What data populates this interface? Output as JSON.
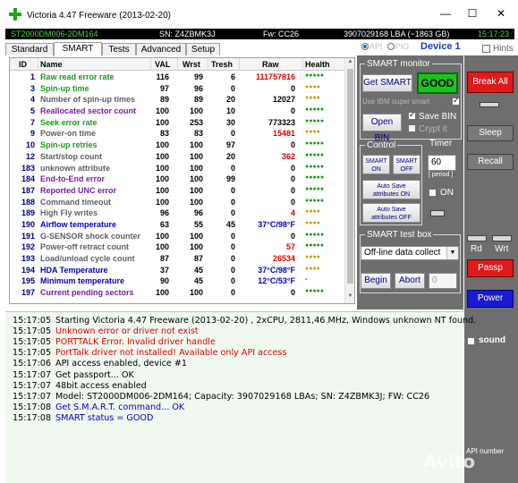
{
  "window": {
    "title": "Victoria 4.47  Freeware (2013-02-20)",
    "minimize": "—",
    "maximize": "☐",
    "close": "✕"
  },
  "infobar": {
    "model": "ST2000DM006-2DM164",
    "sn": "SN: Z4ZBMK3J",
    "fw": "Fw: CC26",
    "lba": "3907029168 LBA (~1863 GB)",
    "time": "15:17:23"
  },
  "tabs": [
    "Standard",
    "SMART",
    "Tests",
    "Advanced",
    "Setup"
  ],
  "active_tab": "SMART",
  "api_options": {
    "api": "API",
    "pio": "PIO",
    "selected": "API"
  },
  "device_label": "Device 1",
  "hints_label": "Hints",
  "table": {
    "headers": [
      "ID",
      "Name",
      "VAL",
      "Wrst",
      "Tresh",
      "Raw",
      "Health"
    ],
    "rows": [
      {
        "id": "1",
        "name": "Raw read error rate",
        "val": "116",
        "wrst": "99",
        "tresh": "6",
        "raw": "111757816",
        "health": "●●●●●",
        "name_color": "#1a9a1a",
        "raw_color": "#e00000",
        "health_color": "#1a9a1a"
      },
      {
        "id": "3",
        "name": "Spin-up time",
        "val": "97",
        "wrst": "96",
        "tresh": "0",
        "raw": "0",
        "health": "●●●●",
        "name_color": "#1a9a1a",
        "raw_color": "#000000",
        "health_color": "#c8a000"
      },
      {
        "id": "4",
        "name": "Number of spin-up times",
        "val": "89",
        "wrst": "89",
        "tresh": "20",
        "raw": "12027",
        "health": "●●●●",
        "name_color": "#606060",
        "raw_color": "#000000",
        "health_color": "#c8a000"
      },
      {
        "id": "5",
        "name": "Reallocated sector count",
        "val": "100",
        "wrst": "100",
        "tresh": "10",
        "raw": "0",
        "health": "●●●●●",
        "name_color": "#7a1aa8",
        "raw_color": "#000000",
        "health_color": "#1a9a1a"
      },
      {
        "id": "7",
        "name": "Seek error rate",
        "val": "100",
        "wrst": "253",
        "tresh": "30",
        "raw": "773323",
        "health": "●●●●●",
        "name_color": "#1a9a1a",
        "raw_color": "#000000",
        "health_color": "#1a9a1a"
      },
      {
        "id": "9",
        "name": "Power-on time",
        "val": "83",
        "wrst": "83",
        "tresh": "0",
        "raw": "15481",
        "health": "●●●●",
        "name_color": "#606060",
        "raw_color": "#e00000",
        "health_color": "#c8a000"
      },
      {
        "id": "10",
        "name": "Spin-up retries",
        "val": "100",
        "wrst": "100",
        "tresh": "97",
        "raw": "0",
        "health": "●●●●●",
        "name_color": "#1a9a1a",
        "raw_color": "#000000",
        "health_color": "#1a9a1a"
      },
      {
        "id": "12",
        "name": "Start/stop count",
        "val": "100",
        "wrst": "100",
        "tresh": "20",
        "raw": "362",
        "health": "●●●●●",
        "name_color": "#606060",
        "raw_color": "#e00000",
        "health_color": "#1a9a1a"
      },
      {
        "id": "183",
        "name": "unknown attribute",
        "val": "100",
        "wrst": "100",
        "tresh": "0",
        "raw": "0",
        "health": "●●●●●",
        "name_color": "#606060",
        "raw_color": "#000000",
        "health_color": "#1a9a1a"
      },
      {
        "id": "184",
        "name": "End-to-End error",
        "val": "100",
        "wrst": "100",
        "tresh": "99",
        "raw": "0",
        "health": "●●●●●",
        "name_color": "#7a1aa8",
        "raw_color": "#000000",
        "health_color": "#1a9a1a"
      },
      {
        "id": "187",
        "name": "Reported UNC error",
        "val": "100",
        "wrst": "100",
        "tresh": "0",
        "raw": "0",
        "health": "●●●●●",
        "name_color": "#7a1aa8",
        "raw_color": "#000000",
        "health_color": "#1a9a1a"
      },
      {
        "id": "188",
        "name": "Command timeout",
        "val": "100",
        "wrst": "100",
        "tresh": "0",
        "raw": "0",
        "health": "●●●●●",
        "name_color": "#606060",
        "raw_color": "#000000",
        "health_color": "#1a9a1a"
      },
      {
        "id": "189",
        "name": "High Fly writes",
        "val": "96",
        "wrst": "96",
        "tresh": "0",
        "raw": "4",
        "health": "●●●●",
        "name_color": "#606060",
        "raw_color": "#e00000",
        "health_color": "#c8a000"
      },
      {
        "id": "190",
        "name": "Airflow temperature",
        "val": "63",
        "wrst": "55",
        "tresh": "45",
        "raw": "37°C/98°F",
        "health": "●●●●",
        "name_color": "#0000c8",
        "raw_color": "#0000c8",
        "health_color": "#c8a000"
      },
      {
        "id": "191",
        "name": "G-SENSOR shock counter",
        "val": "100",
        "wrst": "100",
        "tresh": "0",
        "raw": "0",
        "health": "●●●●●",
        "name_color": "#606060",
        "raw_color": "#000000",
        "health_color": "#1a9a1a"
      },
      {
        "id": "192",
        "name": "Power-off retract count",
        "val": "100",
        "wrst": "100",
        "tresh": "0",
        "raw": "57",
        "health": "●●●●●",
        "name_color": "#606060",
        "raw_color": "#e00000",
        "health_color": "#1a9a1a"
      },
      {
        "id": "193",
        "name": "Load/unload cycle count",
        "val": "87",
        "wrst": "87",
        "tresh": "0",
        "raw": "26534",
        "health": "●●●●",
        "name_color": "#606060",
        "raw_color": "#e00000",
        "health_color": "#c8a000"
      },
      {
        "id": "194",
        "name": "HDA Temperature",
        "val": "37",
        "wrst": "45",
        "tresh": "0",
        "raw": "37°C/98°F",
        "health": "●●●●",
        "name_color": "#0000c8",
        "raw_color": "#0000c8",
        "health_color": "#c8a000"
      },
      {
        "id": "195",
        "name": "Minimum temperature",
        "val": "90",
        "wrst": "45",
        "tresh": "0",
        "raw": "12°C/53°F",
        "health": "-",
        "name_color": "#0000c8",
        "raw_color": "#0000c8",
        "health_color": "#000000"
      },
      {
        "id": "197",
        "name": "Current pending sectors",
        "val": "100",
        "wrst": "100",
        "tresh": "0",
        "raw": "0",
        "health": "●●●●●",
        "name_color": "#7a1aa8",
        "raw_color": "#000000",
        "health_color": "#1a9a1a"
      }
    ]
  },
  "smart_monitor": {
    "title": "SMART monitor",
    "get_smart": "Get SMART",
    "status": "GOOD",
    "status_color": "#19c419",
    "use_ibm": "Use IBM super smart",
    "open_bin": "Open BIN",
    "save_bin": "Save BIN",
    "crypt_it": "Crypt it"
  },
  "control": {
    "title": "Control",
    "smart_on": "SMART ON",
    "smart_off": "SMART OFF",
    "autosave_on": "Auto Save attributes ON",
    "autosave_off": "Auto Save attributes OFF"
  },
  "timer": {
    "title": "Timer",
    "value": "60",
    "period_label": "[ period ]",
    "on_label": "ON"
  },
  "test_box": {
    "title": "SMART test box",
    "selected_test": "Off-line data collect",
    "begin": "Begin",
    "abort": "Abort",
    "progress_value": "0"
  },
  "side_buttons": {
    "break_all": "Break All",
    "sleep": "Sleep",
    "recall": "Recall",
    "rd": "Rd",
    "wrt": "Wrt",
    "passp": "Passp",
    "power": "Power",
    "sound": "sound",
    "api_number": "API number"
  },
  "log": [
    {
      "time": "15:17:05",
      "msg": "Starting Victoria 4.47  Freeware (2013-02-20) , 2xCPU, 2811,46 MHz, Windows unknown NT found.",
      "color": "#000000"
    },
    {
      "time": "15:17:05",
      "msg": "Unknown error or driver not exist",
      "color": "#e00000"
    },
    {
      "time": "15:17:05",
      "msg": "PORTTALK Error. Invalid driver handle",
      "color": "#e00000"
    },
    {
      "time": "15:17:05",
      "msg": "PortTalk driver not installed! Available only API access",
      "color": "#e00000"
    },
    {
      "time": "15:17:06",
      "msg": "API access enabled, device #1",
      "color": "#000000"
    },
    {
      "time": "15:17:07",
      "msg": "Get passport... OK",
      "color": "#000000"
    },
    {
      "time": "15:17:07",
      "msg": "48bit access enabled",
      "color": "#000000"
    },
    {
      "time": "15:17:07",
      "msg": "Model: ST2000DM006-2DM164; Capacity: 3907029168 LBAs; SN: Z4ZBMK3J; FW: CC26",
      "color": "#000000"
    },
    {
      "time": "15:17:08",
      "msg": "Get S.M.A.R.T. command... OK",
      "color": "#0000c8"
    },
    {
      "time": "15:17:08",
      "msg": "SMART status = GOOD",
      "color": "#0000c8"
    }
  ],
  "watermark": "Avito"
}
